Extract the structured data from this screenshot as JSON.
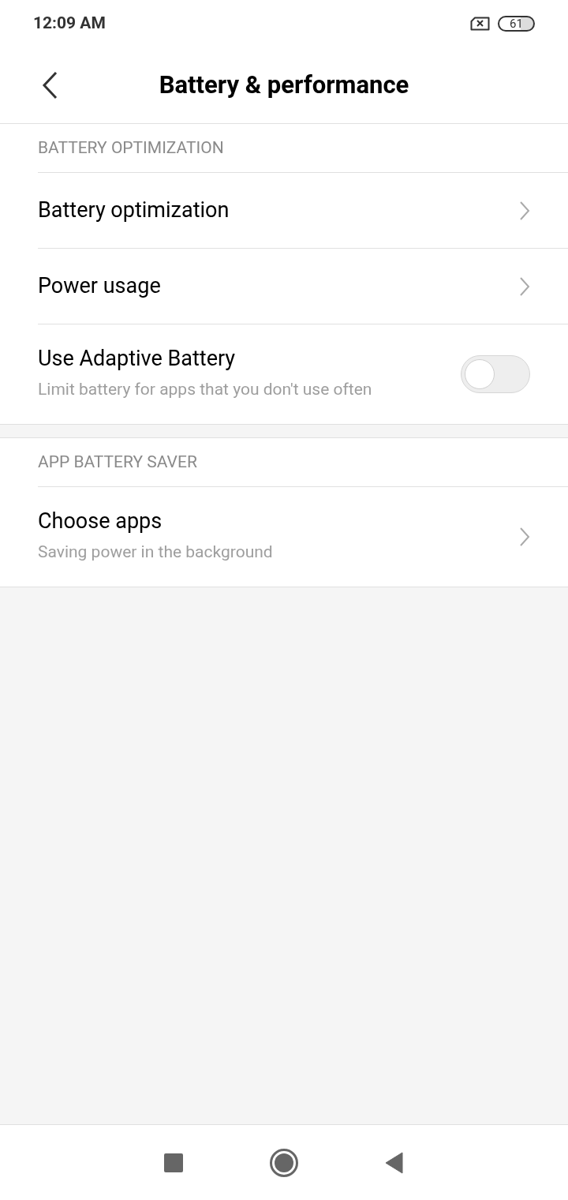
{
  "status_bar": {
    "time": "12:09 AM",
    "battery": "61"
  },
  "header": {
    "title": "Battery & performance"
  },
  "sections": [
    {
      "title": "BATTERY OPTIMIZATION",
      "items": [
        {
          "kind": "link",
          "label": "Battery optimization"
        },
        {
          "kind": "link",
          "label": "Power usage"
        },
        {
          "kind": "toggle",
          "label": "Use Adaptive Battery",
          "subtitle": "Limit battery for apps that you don't use often",
          "on": false
        }
      ]
    },
    {
      "title": "APP BATTERY SAVER",
      "items": [
        {
          "kind": "link",
          "label": "Choose apps",
          "subtitle": "Saving power in the background"
        }
      ]
    }
  ]
}
